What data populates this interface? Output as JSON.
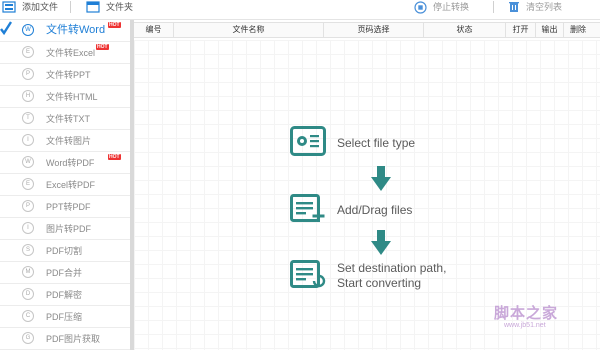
{
  "toolbar": {
    "add_file_label": "添加文件",
    "folder_label": "文件夹",
    "stop_label": "停止转换",
    "clear_label": "清空列表"
  },
  "sidebar": {
    "items": [
      {
        "label": "文件转Word",
        "icon": "W",
        "hot": true,
        "active": true
      },
      {
        "label": "文件转Excel",
        "icon": "E",
        "hot": true
      },
      {
        "label": "文件转PPT",
        "icon": "P"
      },
      {
        "label": "文件转HTML",
        "icon": "H"
      },
      {
        "label": "文件转TXT",
        "icon": "T"
      },
      {
        "label": "文件转图片",
        "icon": "I"
      },
      {
        "label": "Word转PDF",
        "icon": "W",
        "hot": true
      },
      {
        "label": "Excel转PDF",
        "icon": "E"
      },
      {
        "label": "PPT转PDF",
        "icon": "P"
      },
      {
        "label": "图片转PDF",
        "icon": "I"
      },
      {
        "label": "PDF切割",
        "icon": "S"
      },
      {
        "label": "PDF合并",
        "icon": "M"
      },
      {
        "label": "PDF解密",
        "icon": "D"
      },
      {
        "label": "PDF压缩",
        "icon": "C"
      },
      {
        "label": "PDF图片获取",
        "icon": "G"
      }
    ],
    "hot_label": "HOT"
  },
  "table": {
    "columns": [
      "编号",
      "文件名称",
      "页码选择",
      "状态",
      "打开",
      "输出",
      "删除"
    ]
  },
  "steps": {
    "step1": "Select file type",
    "step2": "Add/Drag files",
    "step3_line1": "Set destination path,",
    "step3_line2": "Start converting"
  },
  "watermark": {
    "title": "脚本之家",
    "url": "www.jb51.net"
  },
  "colors": {
    "accent": "#1f7fd6",
    "teal": "#2f8a86",
    "hot": "#e33333"
  },
  "icons": {
    "add_file": "add-file-icon",
    "folder": "folder-icon",
    "stop": "stop-icon",
    "clear": "trash-icon"
  }
}
